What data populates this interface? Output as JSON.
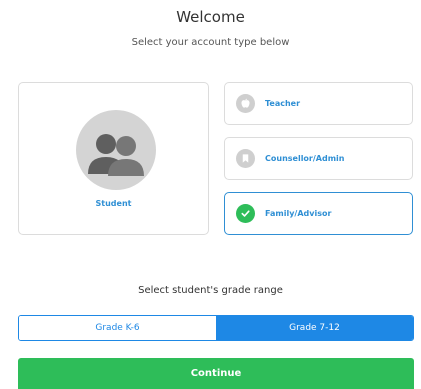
{
  "header": {
    "title": "Welcome",
    "subtitle": "Select your account type below"
  },
  "account_types": {
    "student": {
      "label": "Student",
      "icon": "student-avatar-icon"
    },
    "options": [
      {
        "label": "Teacher",
        "icon": "apple-icon",
        "selected": false
      },
      {
        "label": "Counsellor/Admin",
        "icon": "bookmark-icon",
        "selected": false
      },
      {
        "label": "Family/Advisor",
        "icon": "check-icon",
        "selected": true
      }
    ]
  },
  "grade": {
    "heading": "Select student's grade range",
    "options": [
      {
        "label": "Grade K-6",
        "selected": false
      },
      {
        "label": "Grade 7-12",
        "selected": true
      }
    ]
  },
  "actions": {
    "continue_label": "Continue"
  },
  "colors": {
    "accent": "#1e88e5",
    "link": "#2f8fd4",
    "success": "#2ebd59",
    "border": "#dcdcdc"
  }
}
